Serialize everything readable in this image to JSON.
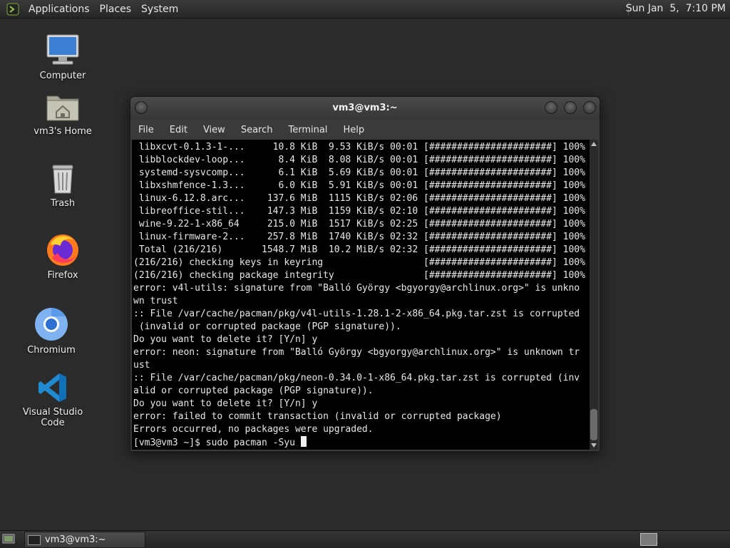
{
  "top_panel": {
    "menus": [
      "Applications",
      "Places",
      "System"
    ],
    "clock": "Sun Jan  5,  7:10 PM"
  },
  "desktop_icons": [
    {
      "label": "Computer",
      "icon": "computer-icon"
    },
    {
      "label": "vm3's Home",
      "icon": "home-folder-icon"
    },
    {
      "label": "Trash",
      "icon": "trash-icon"
    },
    {
      "label": "Firefox",
      "icon": "firefox-icon"
    },
    {
      "label": "Chromium",
      "icon": "chromium-icon"
    },
    {
      "label": "Visual Studio Code",
      "icon": "vscode-icon"
    }
  ],
  "terminal": {
    "title": "vm3@vm3:~",
    "menus": [
      "File",
      "Edit",
      "View",
      "Search",
      "Terminal",
      "Help"
    ],
    "lines": [
      " libxcvt-0.1.3-1-...     10.8 KiB  9.53 KiB/s 00:01 [######################] 100%",
      " libblockdev-loop...      8.4 KiB  8.08 KiB/s 00:01 [######################] 100%",
      " systemd-sysvcomp...      6.1 KiB  5.69 KiB/s 00:01 [######################] 100%",
      " libxshmfence-1.3...      6.0 KiB  5.91 KiB/s 00:01 [######################] 100%",
      " linux-6.12.8.arc...    137.6 MiB  1115 KiB/s 02:06 [######################] 100%",
      " libreoffice-stil...    147.3 MiB  1159 KiB/s 02:10 [######################] 100%",
      " wine-9.22-1-x86_64     215.0 MiB  1517 KiB/s 02:25 [######################] 100%",
      " linux-firmware-2...    257.8 MiB  1740 KiB/s 02:32 [######################] 100%",
      " Total (216/216)       1548.7 MiB  10.2 MiB/s 02:32 [######################] 100%",
      "(216/216) checking keys in keyring                  [######################] 100%",
      "(216/216) checking package integrity                [######################] 100%",
      "error: v4l-utils: signature from \"Balló György <bgyorgy@archlinux.org>\" is unkno",
      "wn trust",
      ":: File /var/cache/pacman/pkg/v4l-utils-1.28.1-2-x86_64.pkg.tar.zst is corrupted",
      " (invalid or corrupted package (PGP signature)).",
      "Do you want to delete it? [Y/n] y",
      "error: neon: signature from \"Balló György <bgyorgy@archlinux.org>\" is unknown tr",
      "ust",
      ":: File /var/cache/pacman/pkg/neon-0.34.0-1-x86_64.pkg.tar.zst is corrupted (inv",
      "alid or corrupted package (PGP signature)).",
      "Do you want to delete it? [Y/n] y",
      "error: failed to commit transaction (invalid or corrupted package)",
      "Errors occurred, no packages were upgraded."
    ],
    "prompt": "[vm3@vm3 ~]$ sudo pacman -Syu "
  },
  "taskbar": {
    "task_label": "vm3@vm3:~"
  }
}
